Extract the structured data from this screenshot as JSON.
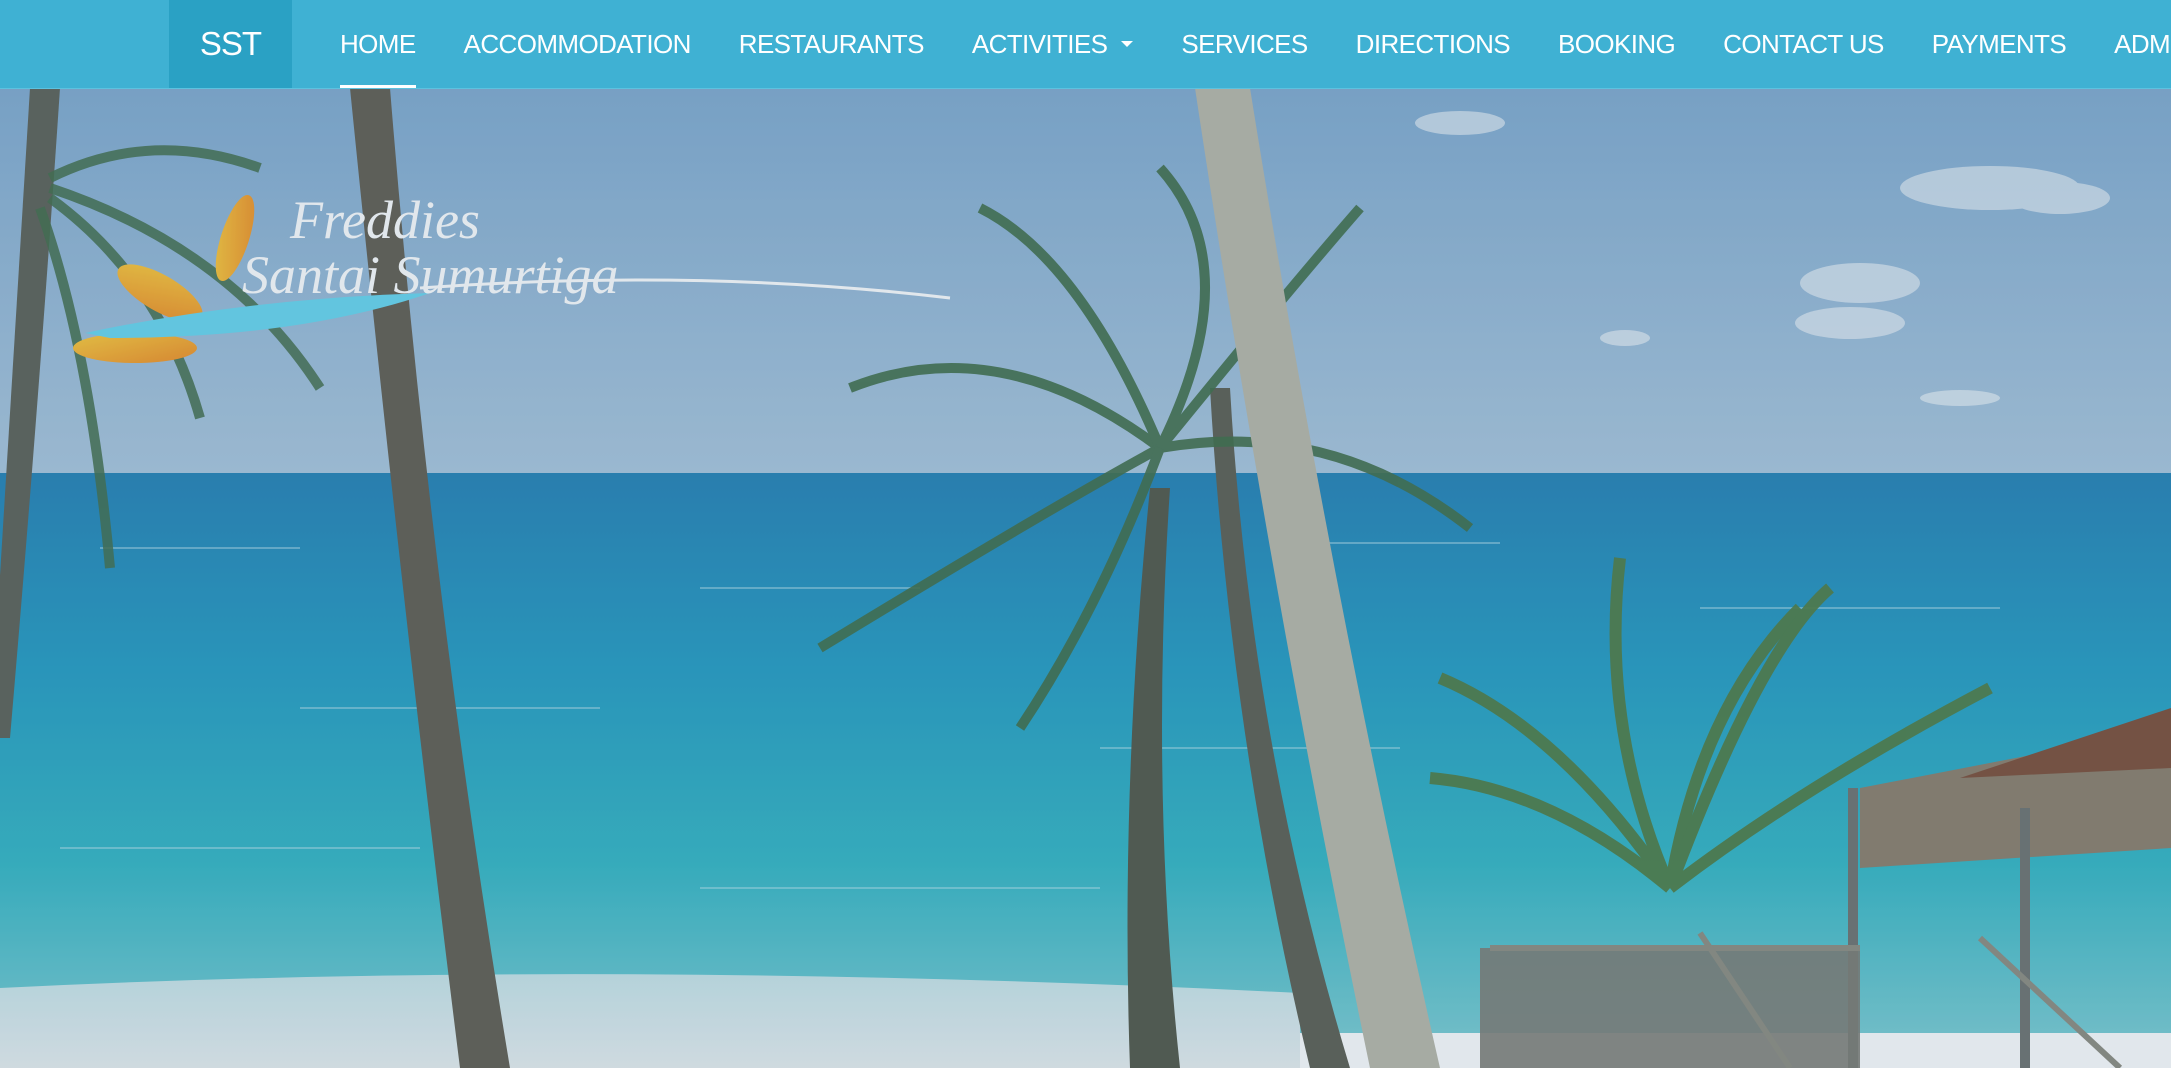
{
  "brand": {
    "label": "SST"
  },
  "nav": {
    "items": [
      {
        "label": "HOME",
        "active": true
      },
      {
        "label": "ACCOMMODATION"
      },
      {
        "label": "RESTAURANTS"
      },
      {
        "label": "ACTIVITIES",
        "dropdown": true
      },
      {
        "label": "SERVICES"
      },
      {
        "label": "DIRECTIONS"
      },
      {
        "label": "BOOKING"
      },
      {
        "label": "CONTACT US"
      },
      {
        "label": "PAYMENTS"
      },
      {
        "label": "ADMIN LOGIN"
      }
    ]
  },
  "logo": {
    "line1": "Freddies",
    "line2": "Santai Sumurtiga"
  },
  "colors": {
    "navbar": "#3fb1d3",
    "brand_bg": "#2aa1c4",
    "sky": "#8fb5d3",
    "sea": "#2aa8c6",
    "sand": "#e8eef0"
  }
}
